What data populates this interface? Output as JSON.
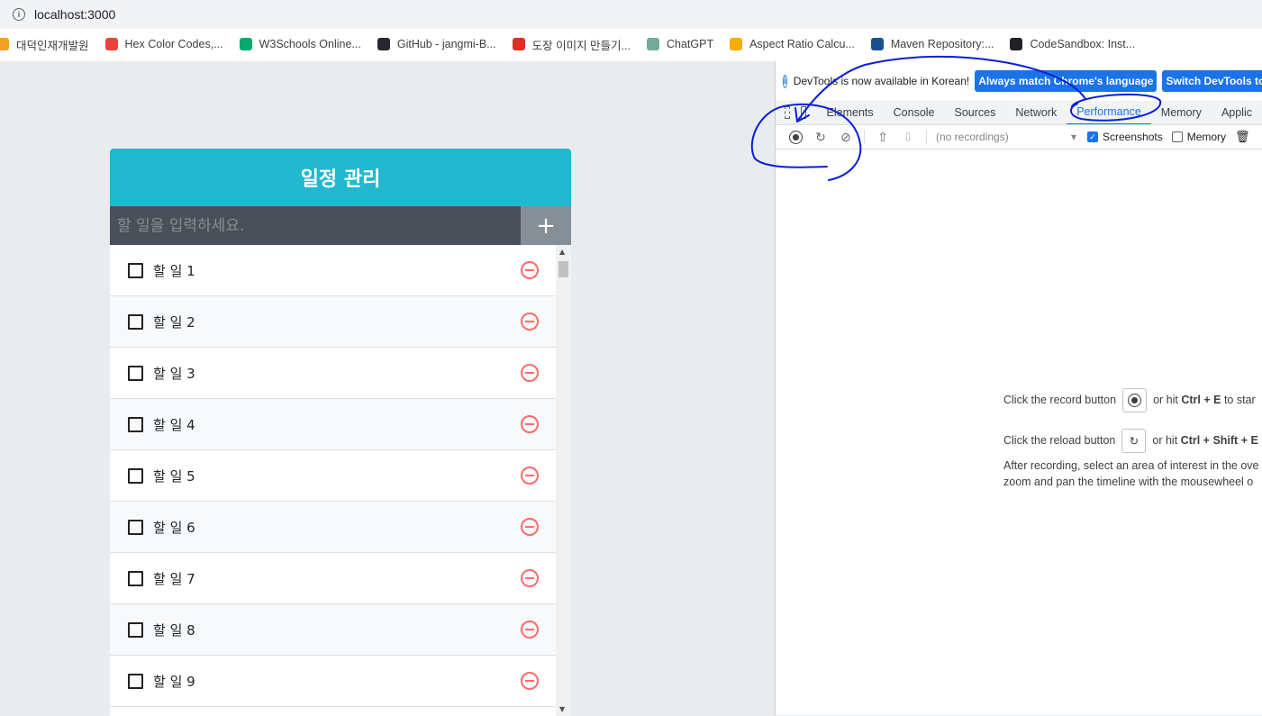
{
  "browser": {
    "url": "localhost:3000",
    "bookmarks": [
      {
        "label": "대덕인재개발원",
        "color": "#f4a025"
      },
      {
        "label": "Hex Color Codes,...",
        "color": "#e8453c"
      },
      {
        "label": "W3Schools Online...",
        "color": "#04aa6d"
      },
      {
        "label": "GitHub - jangmi-B...",
        "color": "#24292f"
      },
      {
        "label": "도장 이미지 만들기...",
        "color": "#d93025"
      },
      {
        "label": "ChatGPT",
        "color": "#74aa9c"
      },
      {
        "label": "Aspect Ratio Calcu...",
        "color": "#f9ab00"
      },
      {
        "label": "Maven Repository:...",
        "color": "#1a4f8b"
      },
      {
        "label": "CodeSandbox: Inst...",
        "color": "#202124"
      }
    ]
  },
  "todo": {
    "title": "일정 관리",
    "input_placeholder": "할 일을 입력하세요.",
    "add_label": "+",
    "items": [
      "할 일 1",
      "할 일 2",
      "할 일 3",
      "할 일 4",
      "할 일 5",
      "할 일 6",
      "할 일 7",
      "할 일 8",
      "할 일 9"
    ]
  },
  "devtools": {
    "info_text": "DevTools is now available in Korean!",
    "btn_match": "Always match Chrome's language",
    "btn_switch": "Switch DevTools to Ko",
    "tabs": [
      "Elements",
      "Console",
      "Sources",
      "Network",
      "Performance",
      "Memory",
      "Applic"
    ],
    "active_tab": "Performance",
    "recordings_placeholder": "(no recordings)",
    "chk_screenshots": "Screenshots",
    "chk_memory": "Memory",
    "landing": {
      "line1_a": "Click the record button",
      "line1_b": "or hit",
      "line1_key": "Ctrl + E",
      "line1_c": "to star",
      "line2_a": "Click the reload button",
      "line2_b": "or hit",
      "line2_key": "Ctrl + Shift + E",
      "para1": "After recording, select an area of interest in the ove",
      "para2": "zoom and pan the timeline with the mousewheel o"
    }
  },
  "colors": {
    "header": "#22b8cf",
    "insert": "#495057",
    "remove": "#ff6b6b",
    "accent": "#1a73e8",
    "annotation": "#0a1fd6"
  }
}
